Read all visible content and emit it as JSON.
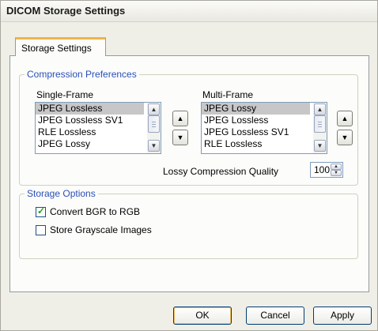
{
  "window": {
    "title": "DICOM Storage Settings"
  },
  "tabs": [
    {
      "label": "Storage Settings",
      "active": true
    }
  ],
  "compression": {
    "group_label": "Compression Preferences",
    "single_frame": {
      "label": "Single-Frame",
      "items": [
        "JPEG Lossless",
        "JPEG Lossless SV1",
        "RLE Lossless",
        "JPEG Lossy"
      ],
      "selected": "JPEG Lossless"
    },
    "multi_frame": {
      "label": "Multi-Frame",
      "items": [
        "JPEG Lossy",
        "JPEG Lossless",
        "JPEG Lossless SV1",
        "RLE Lossless"
      ],
      "selected": "JPEG Lossy"
    },
    "quality": {
      "label": "Lossy Compression Quality",
      "value": "100"
    }
  },
  "storage_options": {
    "group_label": "Storage Options",
    "convert_bgr": {
      "label": "Convert BGR to RGB",
      "checked": true
    },
    "store_grayscale": {
      "label": "Store Grayscale Images",
      "checked": false
    }
  },
  "buttons": {
    "ok": "OK",
    "cancel": "Cancel",
    "apply": "Apply"
  },
  "colors": {
    "group_label": "#2950b8",
    "tab_accent": "#f1b44a",
    "check_mark": "#21a121",
    "selection": "#c7c7c7"
  }
}
